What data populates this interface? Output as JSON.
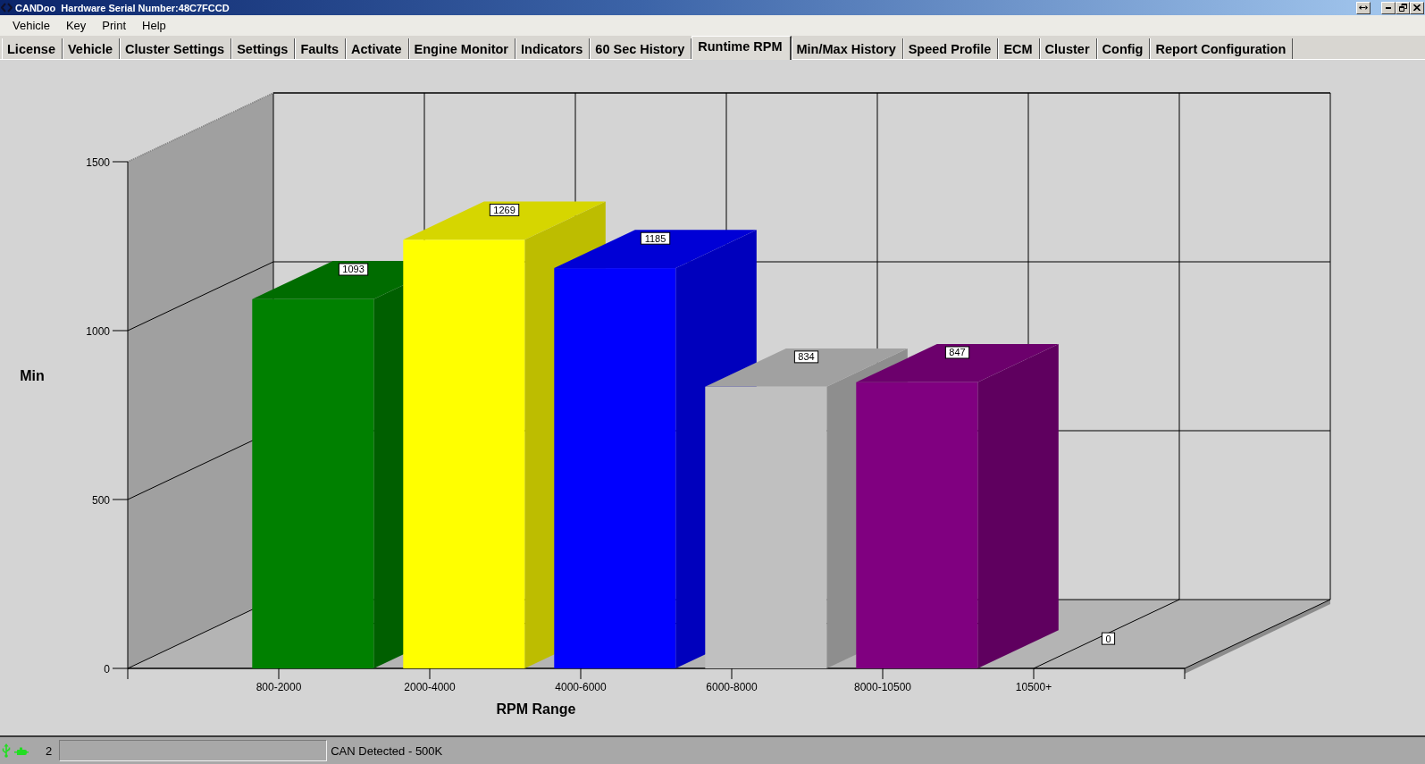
{
  "window": {
    "title": "CANDoo  Hardware Serial Number:48C7FCCD"
  },
  "menu": [
    {
      "label": "Vehicle"
    },
    {
      "label": "Key"
    },
    {
      "label": "Print"
    },
    {
      "label": "Help"
    }
  ],
  "tabs": [
    {
      "label": "License",
      "selected": false
    },
    {
      "label": "Vehicle",
      "selected": false
    },
    {
      "label": "Cluster Settings",
      "selected": false
    },
    {
      "label": "Settings",
      "selected": false
    },
    {
      "label": "Faults",
      "selected": false
    },
    {
      "label": "Activate",
      "selected": false
    },
    {
      "label": "Engine Monitor",
      "selected": false
    },
    {
      "label": "Indicators",
      "selected": false
    },
    {
      "label": "60 Sec History",
      "selected": false
    },
    {
      "label": "Runtime RPM",
      "selected": true
    },
    {
      "label": "Min/Max History",
      "selected": false
    },
    {
      "label": "Speed Profile",
      "selected": false
    },
    {
      "label": "ECM",
      "selected": false
    },
    {
      "label": "Cluster",
      "selected": false
    },
    {
      "label": "Config",
      "selected": false
    },
    {
      "label": "Report Configuration",
      "selected": false
    }
  ],
  "chart": {
    "chart_data": {
      "type": "bar",
      "xlabel": "RPM Range",
      "ylabel": "Min",
      "categories": [
        "800-2000",
        "2000-4000",
        "4000-6000",
        "6000-8000",
        "8000-10500",
        "10500+"
      ],
      "series": [
        {
          "values": [
            1093,
            1269,
            1185,
            834,
            847,
            0
          ],
          "colors": [
            "#008000",
            "#ffff00",
            "#0000ff",
            "#c0c0c0",
            "#800080",
            null
          ]
        }
      ],
      "ylim": [
        0,
        1500
      ],
      "yticks": [
        0,
        500,
        1000,
        1500
      ],
      "value_labels": [
        "1093",
        "1269",
        "1185",
        "834",
        "847",
        "0"
      ]
    }
  },
  "status_bar": {
    "number": "2",
    "message": "CAN Detected - 500K"
  }
}
